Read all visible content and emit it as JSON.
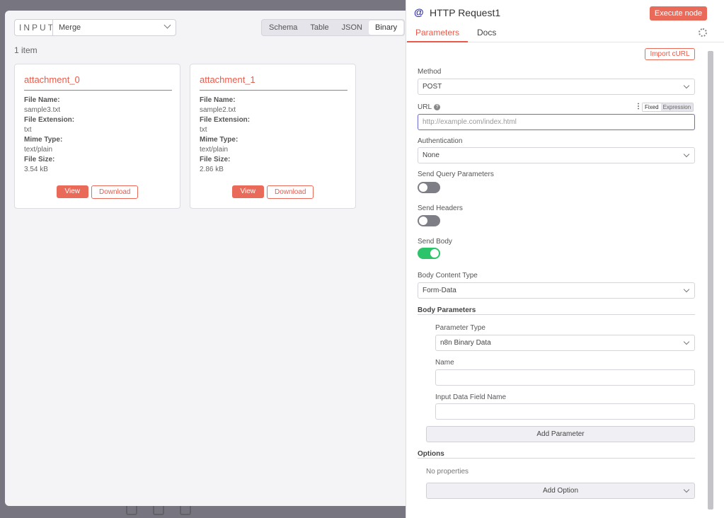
{
  "input_panel": {
    "label": "INPUT",
    "source": "Merge",
    "view_tabs": [
      "Schema",
      "Table",
      "JSON",
      "Binary"
    ],
    "active_tab": "Binary",
    "item_count": "1 item",
    "cards": [
      {
        "title": "attachment_0",
        "fields": [
          {
            "key": "File Name:",
            "value": "sample3.txt"
          },
          {
            "key": "File Extension:",
            "value": "txt"
          },
          {
            "key": "Mime Type:",
            "value": "text/plain"
          },
          {
            "key": "File Size:",
            "value": "3.54 kB"
          }
        ],
        "view_label": "View",
        "download_label": "Download"
      },
      {
        "title": "attachment_1",
        "fields": [
          {
            "key": "File Name:",
            "value": "sample2.txt"
          },
          {
            "key": "File Extension:",
            "value": "txt"
          },
          {
            "key": "Mime Type:",
            "value": "text/plain"
          },
          {
            "key": "File Size:",
            "value": "2.86 kB"
          }
        ],
        "view_label": "View",
        "download_label": "Download"
      }
    ]
  },
  "node": {
    "icon": "@",
    "title": "HTTP Request1",
    "execute_label": "Execute node",
    "tabs": {
      "parameters": "Parameters",
      "docs": "Docs"
    },
    "import_curl": "Import cURL",
    "method": {
      "label": "Method",
      "value": "POST"
    },
    "url": {
      "label": "URL",
      "placeholder": "http://example.com/index.html",
      "mode_fixed": "Fixed",
      "mode_expression": "Expression"
    },
    "authentication": {
      "label": "Authentication",
      "value": "None"
    },
    "send_query": {
      "label": "Send Query Parameters",
      "enabled": false
    },
    "send_headers": {
      "label": "Send Headers",
      "enabled": false
    },
    "send_body": {
      "label": "Send Body",
      "enabled": true
    },
    "body_content_type": {
      "label": "Body Content Type",
      "value": "Form-Data"
    },
    "body_parameters": {
      "label": "Body Parameters",
      "parameter_type": {
        "label": "Parameter Type",
        "value": "n8n Binary Data"
      },
      "name": {
        "label": "Name",
        "value": ""
      },
      "input_data_field": {
        "label": "Input Data Field Name",
        "value": ""
      },
      "add_label": "Add Parameter"
    },
    "options": {
      "label": "Options",
      "empty_text": "No properties",
      "add_label": "Add Option"
    }
  },
  "colors": {
    "accent": "#ea5a4a",
    "toggle_on": "#2bc46a",
    "toggle_off": "#7e7e86"
  }
}
